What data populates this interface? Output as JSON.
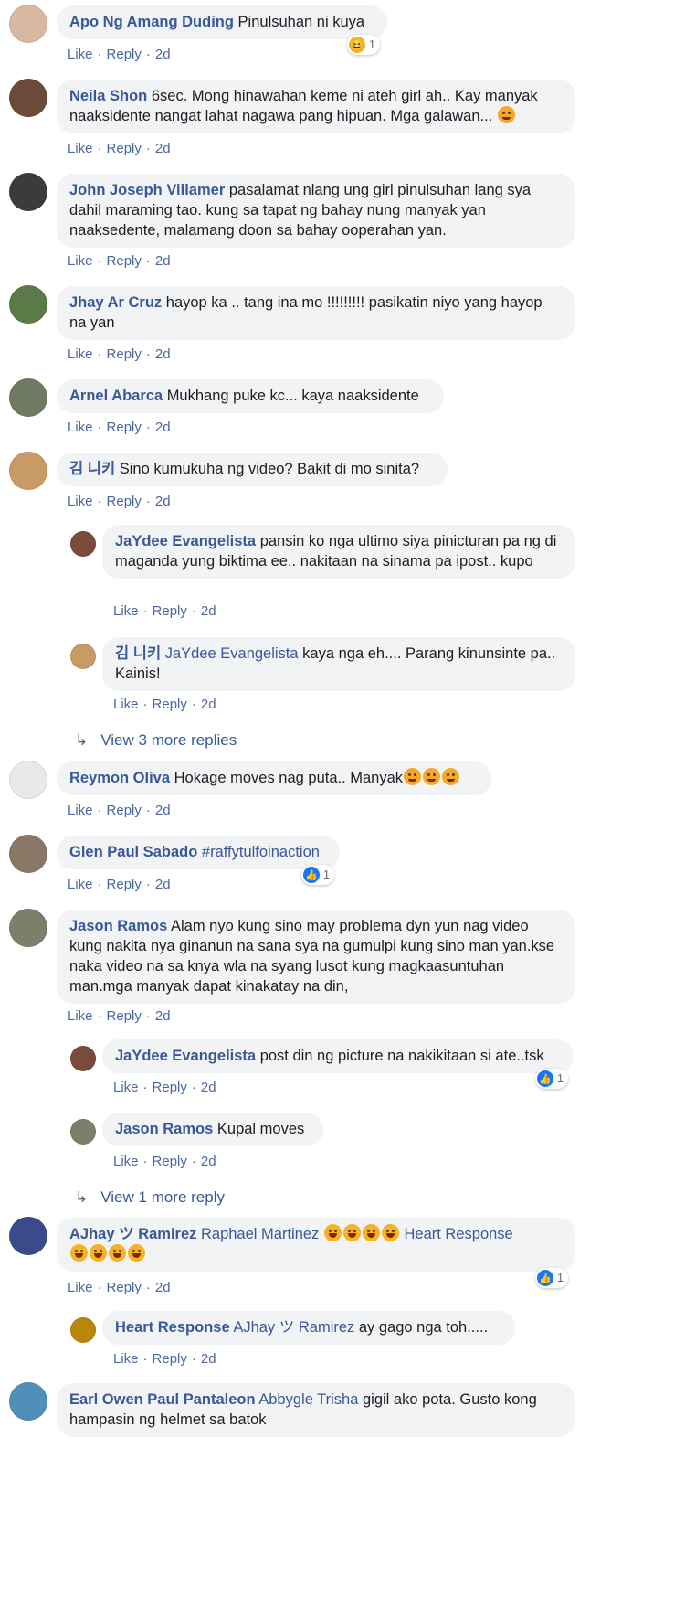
{
  "actions": {
    "like": "Like",
    "reply": "Reply",
    "dot": "·"
  },
  "comments": [
    {
      "author": "Apo Ng Amang Duding",
      "text": "Pinulsuhan ni kuya",
      "time": "2d",
      "reaction_count": "1"
    },
    {
      "author": "Neila Shon",
      "text": "6sec. Mong hinawahan keme ni ateh girl ah.. Kay manyak naaksidente nangat lahat nagawa pang hipuan. Mga galawan...",
      "time": "2d"
    },
    {
      "author": "John Joseph Villamer",
      "text": "pasalamat nlang ung girl pinulsuhan lang sya dahil maraming tao. kung sa tapat ng bahay nung manyak yan naaksedente, malamang doon sa bahay ooperahan yan.",
      "time": "2d"
    },
    {
      "author": "Jhay Ar Cruz",
      "text": "hayop ka .. tang ina mo !!!!!!!!! pasikatin niyo yang hayop na yan",
      "time": "2d"
    },
    {
      "author": "Arnel Abarca",
      "text": "Mukhang puke kc... kaya naaksidente",
      "time": "2d"
    },
    {
      "author": "김 니키",
      "text": "Sino kumukuha ng video? Bakit di mo sinita?",
      "time": "2d"
    },
    {
      "author": "JaYdee Evangelista",
      "text": "pansin ko nga ultimo siya pinicturan pa ng di maganda yung biktima ee.. nakitaan na sinama pa ipost.. kupo",
      "time": "2d"
    },
    {
      "author": "김 니키",
      "tag": "JaYdee Evangelista",
      "text": "kaya nga eh.... Parang kinunsinte pa.. Kainis!",
      "time": "2d"
    },
    {
      "author": "Reymon Oliva",
      "text": "Hokage moves nag puta.. Manyak",
      "time": "2d"
    },
    {
      "author": "Glen Paul Sabado",
      "tag": "#raffytulfoinaction",
      "time": "2d",
      "reaction_count": "1"
    },
    {
      "author": "Jason Ramos",
      "text": "Alam nyo kung sino may problema dyn yun nag video kung nakita nya ginanun na sana sya na gumulpi kung sino man yan.kse naka video na sa knya wla na syang lusot kung magkaasuntuhan man.mga manyak dapat kinakatay na din,",
      "time": "2d"
    },
    {
      "author": "JaYdee Evangelista",
      "text": "post din ng picture na nakikitaan si ate..tsk",
      "time": "2d",
      "reaction_count": "1"
    },
    {
      "author": "Jason Ramos",
      "text": "Kupal moves",
      "time": "2d"
    },
    {
      "author": "AJhay ツ Ramirez",
      "tag": "Raphael Martinez",
      "tag2": "Heart Response",
      "time": "2d",
      "reaction_count": "1"
    },
    {
      "author": "Heart Response",
      "tag": "AJhay ツ Ramirez",
      "text": "ay gago nga toh.....",
      "time": "2d"
    },
    {
      "author": "Earl Owen Paul Pantaleon",
      "tag": "Abbygle Trisha",
      "text": "gigil ako pota. Gusto kong hampasin ng helmet sa batok"
    }
  ],
  "view_more": [
    "View 3 more replies",
    "View 1 more reply"
  ],
  "colors": {
    "link": "#385898",
    "bubble": "#f2f3f5",
    "like_blue": "#1877f2"
  }
}
